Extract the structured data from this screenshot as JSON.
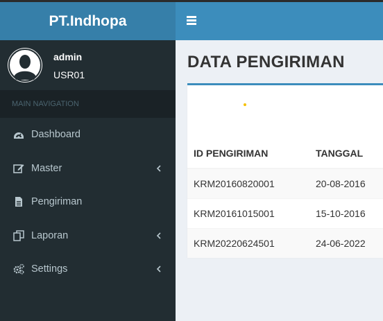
{
  "brand": {
    "title": "PT.Indhopa"
  },
  "user": {
    "name": "admin",
    "id": "USR01"
  },
  "sidebar": {
    "header": "MAIN NAVIGATION",
    "items": [
      {
        "label": "Dashboard",
        "icon": "dashboard-icon",
        "has_submenu": false
      },
      {
        "label": "Master",
        "icon": "edit-icon",
        "has_submenu": true
      },
      {
        "label": "Pengiriman",
        "icon": "file-icon",
        "has_submenu": false
      },
      {
        "label": "Laporan",
        "icon": "copy-icon",
        "has_submenu": true
      },
      {
        "label": "Settings",
        "icon": "gears-icon",
        "has_submenu": true
      }
    ]
  },
  "main": {
    "title": "DATA PENGIRIMAN",
    "table": {
      "headers": [
        "ID PENGIRIMAN",
        "TANGGAL"
      ],
      "rows": [
        [
          "KRM20160820001",
          "20-08-2016"
        ],
        [
          "KRM20161015001",
          "15-10-2016"
        ],
        [
          "KRM20220624501",
          "24-06-2022"
        ]
      ]
    }
  },
  "colors": {
    "logo_bg": "#367fa9",
    "navbar_bg": "#3c8dbc",
    "sidebar_bg": "#222d32",
    "sidebar_header_bg": "#1a2226",
    "content_bg": "#ecf0f5",
    "box_border": "#3c8dbc"
  }
}
